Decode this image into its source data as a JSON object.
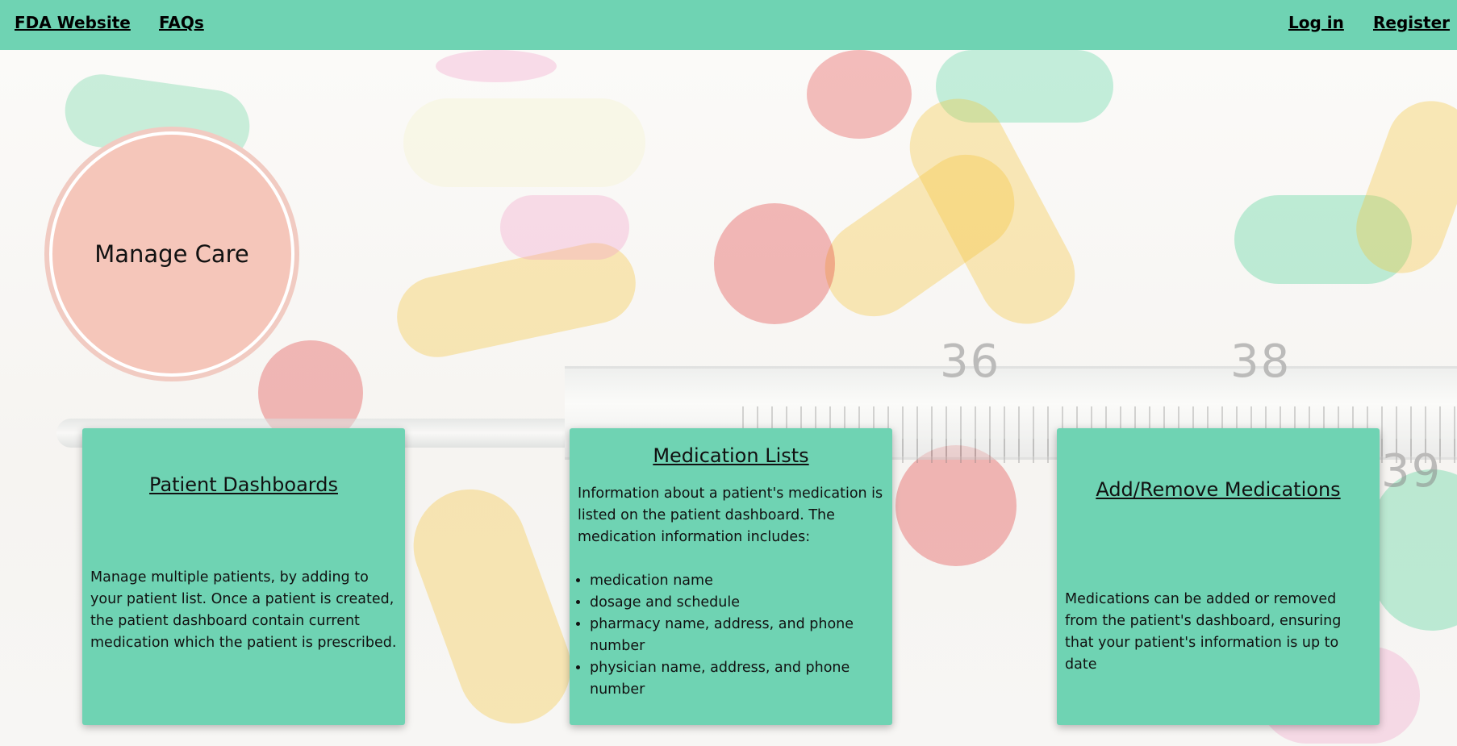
{
  "nav": {
    "fda_website": "FDA Website",
    "faqs": "FAQs",
    "log_in": "Log in",
    "register": "Register"
  },
  "hero": {
    "title": "Manage Care"
  },
  "background": {
    "thermometer_labels": [
      "36",
      "38",
      "39"
    ]
  },
  "cards": [
    {
      "title": "Patient Dashboards",
      "text": "Manage multiple patients, by adding to your patient list. Once a patient is created, the patient dashboard contain current medication which the patient is prescribed."
    },
    {
      "title": "Medication Lists",
      "intro": "Information about a patient's medication is listed on the patient dashboard. The medication information includes:",
      "items": [
        "medication name",
        "dosage and schedule",
        "pharmacy name, address, and phone number",
        "physician name, address, and phone number"
      ]
    },
    {
      "title": "Add/Remove Medications",
      "text": "Medications can be added or removed from the patient's dashboard, ensuring that your patient's information is up to date"
    }
  ],
  "colors": {
    "accent": "#6fd3b3",
    "circle": "#f5c6ba",
    "circle_ring": "#f1cbc2"
  },
  "icons": []
}
